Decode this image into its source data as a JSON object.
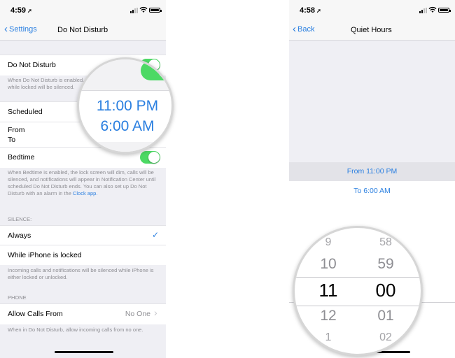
{
  "left_screen": {
    "status_time": "4:59",
    "nav": {
      "back_label": "Settings",
      "title": "Do Not Disturb"
    },
    "dnd": {
      "label": "Do Not Disturb",
      "enabled": true,
      "footer": "When Do Not Disturb is enabled, calls and alerts that arrive while locked will be silenced."
    },
    "schedule": {
      "scheduled_label": "Scheduled",
      "from_label": "From",
      "to_label": "To",
      "bedtime_label": "Bedtime",
      "bedtime_footer": "When Bedtime is enabled, the lock screen will dim, calls will be silenced, and notifications will appear in Notification Center until scheduled Do Not Disturb ends. You can also set up Do Not Disturb with an alarm in the",
      "bedtime_footer_link": "Clock app."
    },
    "silence": {
      "header": "SILENCE:",
      "options": [
        {
          "label": "Always",
          "selected": true
        },
        {
          "label": "While iPhone is locked",
          "selected": false
        }
      ],
      "footer": "Incoming calls and notifications will be silenced while iPhone is either locked or unlocked."
    },
    "phone": {
      "header": "PHONE",
      "allow_calls_label": "Allow Calls From",
      "allow_calls_value": "No One",
      "footer": "When in Do Not Disturb, allow incoming calls from no one."
    },
    "magnifier": {
      "from_time": "11:00 PM",
      "to_time": "6:00 AM"
    }
  },
  "right_screen": {
    "status_time": "4:58",
    "nav": {
      "back_label": "Back",
      "title": "Quiet Hours"
    },
    "from_row": "From 11:00 PM",
    "to_row": "To 6:00 AM",
    "picker": {
      "hours": [
        "9",
        "10",
        "11",
        "12",
        "1"
      ],
      "minutes": [
        "58",
        "59",
        "00",
        "01",
        "02"
      ],
      "selected_hour": "11",
      "selected_minute": "00"
    }
  },
  "colors": {
    "accent": "#2a7fe0",
    "toggle_on": "#4cd964",
    "background": "#efeff4"
  }
}
